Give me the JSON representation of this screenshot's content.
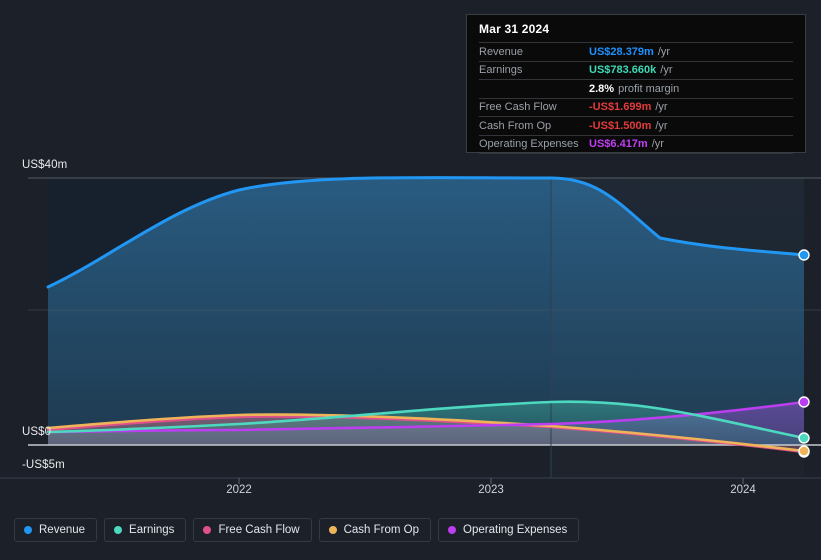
{
  "chart_data": {
    "type": "area",
    "title": "",
    "xlabel": "",
    "ylabel": "",
    "x": [
      "2021.3",
      "2022",
      "2023",
      "2024",
      "2024.35"
    ],
    "x_tick_labels": [
      "2022",
      "2023",
      "2024"
    ],
    "y_tick_labels": [
      "US$40m",
      "US$0",
      "-US$5m"
    ],
    "ylim": [
      -5,
      40
    ],
    "grid": true,
    "legend_position": "bottom-left",
    "currency_unit": "US$ millions",
    "series": [
      {
        "name": "Revenue",
        "color": "#2196f3",
        "values": [
          23.6,
          36.5,
          38.3,
          30.1,
          28.379
        ]
      },
      {
        "name": "Earnings",
        "color": "#4dd8c0",
        "values": [
          0.05,
          0.55,
          2.35,
          1.05,
          0.78366
        ]
      },
      {
        "name": "Free Cash Flow",
        "color": "#e0518b",
        "values": [
          0.35,
          1.35,
          0.85,
          -1.35,
          -1.699
        ]
      },
      {
        "name": "Cash From Op",
        "color": "#efb45a",
        "values": [
          0.45,
          1.55,
          1.0,
          -1.2,
          -1.5
        ]
      },
      {
        "name": "Operating Expenses",
        "color": "#bb3ef0",
        "values": [
          0.1,
          0.35,
          0.6,
          1.45,
          6.417
        ]
      }
    ]
  },
  "y_axis": {
    "top_label": "US$40m",
    "zero_label": "US$0",
    "bottom_label": "-US$5m"
  },
  "x_axis": {
    "ticks": [
      "2022",
      "2023",
      "2024"
    ]
  },
  "tooltip": {
    "date": "Mar 31 2024",
    "rows": [
      {
        "label": "Revenue",
        "value": "US$28.379m",
        "unit": "/yr",
        "color": "#1e90ff",
        "sub": ""
      },
      {
        "label": "Earnings",
        "value": "US$783.660k",
        "unit": "/yr",
        "color": "#3fd8b5",
        "sub": ""
      },
      {
        "label": "",
        "value": "2.8%",
        "unit": "",
        "color": "#ffffff",
        "sub": "profit margin"
      },
      {
        "label": "Free Cash Flow",
        "value": "-US$1.699m",
        "unit": "/yr",
        "color": "#e23b3b",
        "sub": ""
      },
      {
        "label": "Cash From Op",
        "value": "-US$1.500m",
        "unit": "/yr",
        "color": "#e23b3b",
        "sub": ""
      },
      {
        "label": "Operating Expenses",
        "value": "US$6.417m",
        "unit": "/yr",
        "color": "#c03ff5",
        "sub": ""
      }
    ]
  },
  "legend": {
    "items": [
      {
        "label": "Revenue",
        "color": "#2196f3"
      },
      {
        "label": "Earnings",
        "color": "#4dd8c0"
      },
      {
        "label": "Free Cash Flow",
        "color": "#e0518b"
      },
      {
        "label": "Cash From Op",
        "color": "#efb45a"
      },
      {
        "label": "Operating Expenses",
        "color": "#bb3ef0"
      }
    ]
  }
}
